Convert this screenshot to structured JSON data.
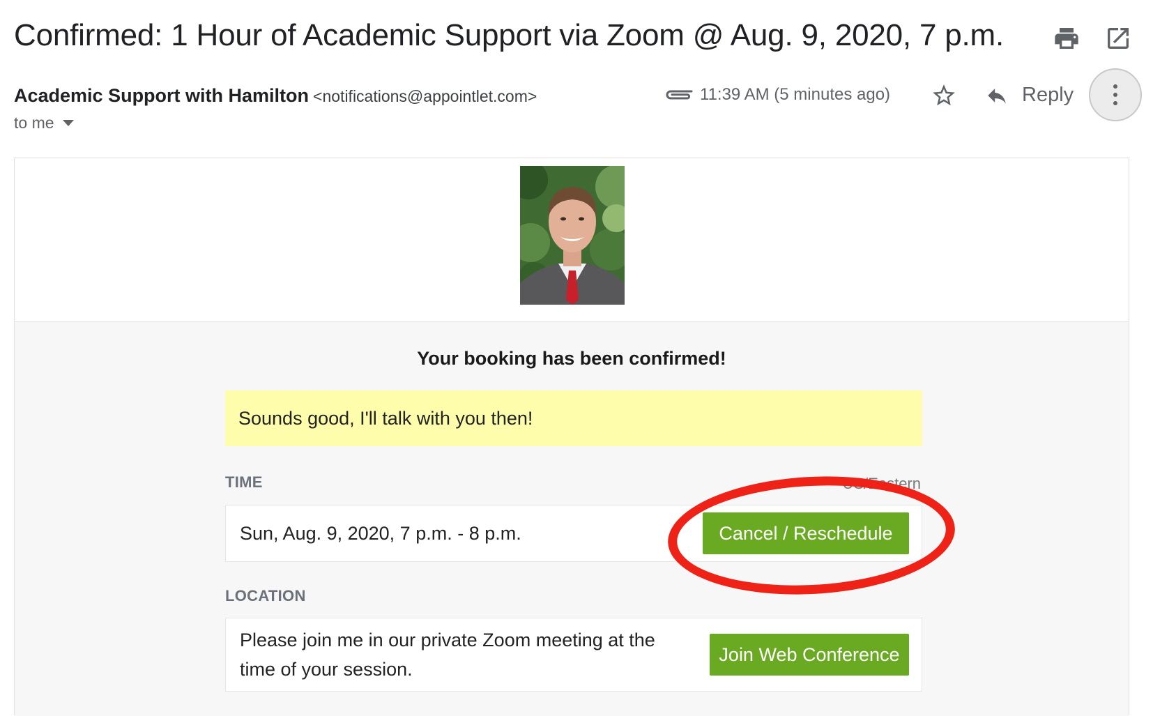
{
  "email": {
    "subject": "Confirmed: 1 Hour of Academic Support via Zoom @ Aug. 9, 2020, 7 p.m.",
    "sender_name": "Academic Support with Hamilton",
    "sender_email": "<notifications@appointlet.com>",
    "recipient": "to me",
    "timestamp": "11:39 AM (5 minutes ago)",
    "reply_label": "Reply"
  },
  "icons": {
    "print": "print-icon",
    "popout": "open-in-new-window-icon",
    "attachment": "attachment-icon",
    "star": "star-icon",
    "reply": "reply-icon",
    "more": "more-vertical-icon"
  },
  "body": {
    "confirm_title": "Your booking has been confirmed!",
    "note": "Sounds good, I'll talk with you then!",
    "time_label": "TIME",
    "timezone": "US/Eastern",
    "time_value": "Sun, Aug. 9, 2020, 7 p.m. - 8 p.m.",
    "cancel_button": "Cancel / Reschedule",
    "location_label": "LOCATION",
    "location_value": "Please join me in our private Zoom meeting at the time of your session.",
    "join_button": "Join Web Conference"
  },
  "colors": {
    "button_green": "#6aaa22",
    "note_yellow": "#fdfdac",
    "highlight_red": "#ee2216"
  }
}
